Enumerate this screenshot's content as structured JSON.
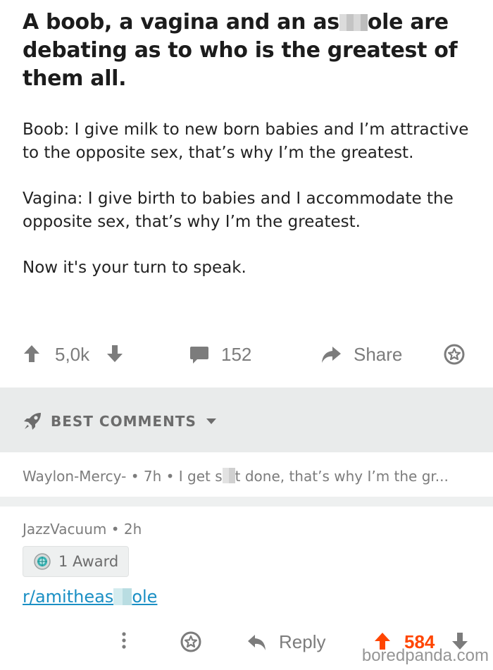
{
  "post": {
    "title_part1": "A boob, a vagina and an as",
    "title_part2": "ole are debating as to who is the greatest of them all.",
    "p1": "Boob: I give milk to new born babies and I’m attractive to the opposite sex, that’s why I’m the greatest.",
    "p2": "Vagina: I give birth to babies and I accommodate the opposite sex, that’s why I’m the greatest.",
    "p3": "Now it's your turn to speak."
  },
  "actions": {
    "votes": "5,0k",
    "comments": "152",
    "share": "Share"
  },
  "sort": {
    "label": "BEST COMMENTS"
  },
  "comment1": {
    "author": "Waylon-Mercy-",
    "age": "7h",
    "text_part1": "I get s",
    "text_part2": "t done, that’s why I’m the gr..."
  },
  "comment2": {
    "author": "JazzVacuum",
    "age": "2h",
    "award": "1 Award",
    "link_part1": "r/amitheas",
    "link_part2": "ole",
    "reply": "Reply",
    "votes": "584"
  },
  "watermark": "boredpanda.com",
  "colors": {
    "accent_orange": "#ff4500",
    "link_blue": "#1a8fc4",
    "icon_gray": "#7c7c7c"
  }
}
